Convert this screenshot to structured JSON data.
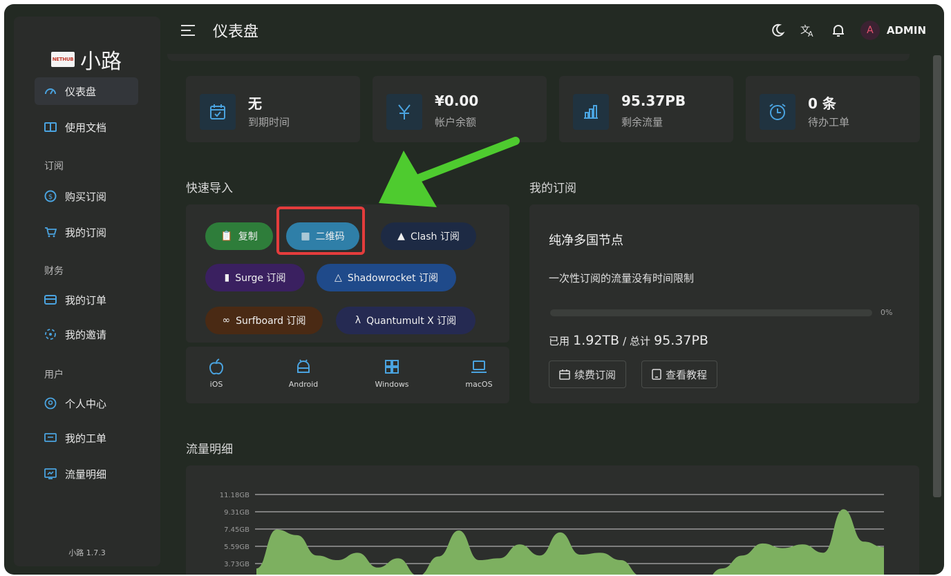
{
  "app": {
    "logo_badge": "NETHUB",
    "name": "小路",
    "version": "小路 1.7.3"
  },
  "header": {
    "title": "仪表盘",
    "user_initial": "A",
    "username": "ADMIN"
  },
  "sidebar": {
    "items": [
      {
        "label": "仪表盘",
        "icon": "dashboard-icon",
        "active": true
      },
      {
        "label": "使用文档",
        "icon": "book-icon"
      }
    ],
    "groups": [
      {
        "title": "订阅",
        "items": [
          {
            "label": "购买订阅",
            "icon": "dollar-icon"
          },
          {
            "label": "我的订阅",
            "icon": "cart-icon"
          }
        ]
      },
      {
        "title": "财务",
        "items": [
          {
            "label": "我的订单",
            "icon": "wallet-icon"
          },
          {
            "label": "我的邀请",
            "icon": "invite-icon"
          }
        ]
      },
      {
        "title": "用户",
        "items": [
          {
            "label": "个人中心",
            "icon": "user-circle-icon"
          },
          {
            "label": "我的工单",
            "icon": "ticket-icon"
          },
          {
            "label": "流量明细",
            "icon": "traffic-icon"
          }
        ]
      }
    ]
  },
  "stats": [
    {
      "value": "无",
      "label": "到期时间",
      "icon": "calendar-icon"
    },
    {
      "value": "¥0.00",
      "label": "帐户余额",
      "icon": "yen-icon"
    },
    {
      "value": "95.37PB",
      "label": "剩余流量",
      "icon": "bar-chart-icon"
    },
    {
      "value": "0 条",
      "label": "待办工单",
      "icon": "alarm-icon"
    }
  ],
  "quick_import": {
    "title": "快速导入",
    "buttons": [
      {
        "label": "复制",
        "icon": "clipboard-icon",
        "color": "#2e7d3a"
      },
      {
        "label": "二维码",
        "icon": "qrcode-icon",
        "color": "#2f7fa8"
      },
      {
        "label": "Clash 订阅",
        "icon": "clash-icon",
        "color": "#1d2a44"
      },
      {
        "label": "Surge 订阅",
        "icon": "surge-icon",
        "color": "#3a2060"
      },
      {
        "label": "Shadowrocket 订阅",
        "icon": "rocket-icon",
        "color": "#1f4a8a"
      },
      {
        "label": "Surfboard 订阅",
        "icon": "surfboard-icon",
        "color": "#4a2a14"
      },
      {
        "label": "Quantumult X 订阅",
        "icon": "quantumult-icon",
        "color": "#252a52"
      }
    ],
    "platforms": [
      {
        "label": "iOS",
        "icon": "apple-icon"
      },
      {
        "label": "Android",
        "icon": "android-icon"
      },
      {
        "label": "Windows",
        "icon": "windows-icon"
      },
      {
        "label": "macOS",
        "icon": "laptop-icon"
      }
    ]
  },
  "subscription": {
    "title": "我的订阅",
    "plan_name": "纯净多国节点",
    "description": "一次性订阅的流量没有时间限制",
    "progress_percent": 0,
    "progress_label": "0%",
    "used_prefix": "已用",
    "used_value": "1.92TB",
    "total_prefix": "/ 总计",
    "total_value": "95.37PB",
    "renew_label": "续费订阅",
    "tutorial_label": "查看教程"
  },
  "traffic": {
    "title": "流量明细",
    "chart_data": {
      "type": "area",
      "y_ticks": [
        "11.18GB",
        "9.31GB",
        "7.45GB",
        "5.59GB",
        "3.73GB"
      ],
      "series": [
        {
          "values": [
            3.2,
            7.4,
            6.8,
            4.6,
            4.1,
            4.9,
            3.3,
            4.3,
            2.4,
            4.5,
            7.3,
            4.1,
            4.3,
            5.8,
            4.6,
            7.1,
            4.7,
            4.9,
            4.1,
            2.4,
            1.4,
            0.6,
            1.6,
            3.2,
            4.6,
            5.9,
            5.4,
            5.8,
            4.9,
            9.6,
            6.1,
            5.5
          ]
        }
      ],
      "color": "#7db060",
      "grid": true
    }
  }
}
